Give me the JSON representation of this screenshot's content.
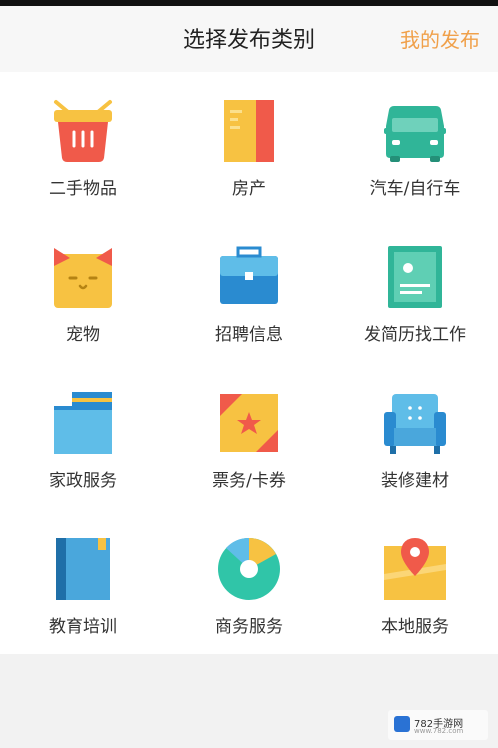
{
  "header": {
    "title": "选择发布类别",
    "my_posts": "我的发布"
  },
  "categories": [
    {
      "label": "二手物品",
      "icon": "basket-icon"
    },
    {
      "label": "房产",
      "icon": "door-icon"
    },
    {
      "label": "汽车/自行车",
      "icon": "car-icon"
    },
    {
      "label": "宠物",
      "icon": "cat-icon"
    },
    {
      "label": "招聘信息",
      "icon": "briefcase-icon"
    },
    {
      "label": "发简历找工作",
      "icon": "resume-icon"
    },
    {
      "label": "家政服务",
      "icon": "box-icon"
    },
    {
      "label": "票务/卡券",
      "icon": "ticket-icon"
    },
    {
      "label": "装修建材",
      "icon": "armchair-icon"
    },
    {
      "label": "教育培训",
      "icon": "book-icon"
    },
    {
      "label": "商务服务",
      "icon": "pie-chart-icon"
    },
    {
      "label": "本地服务",
      "icon": "map-pin-icon"
    }
  ],
  "watermark": {
    "text": "782手游网",
    "sub": "www.782.com"
  }
}
